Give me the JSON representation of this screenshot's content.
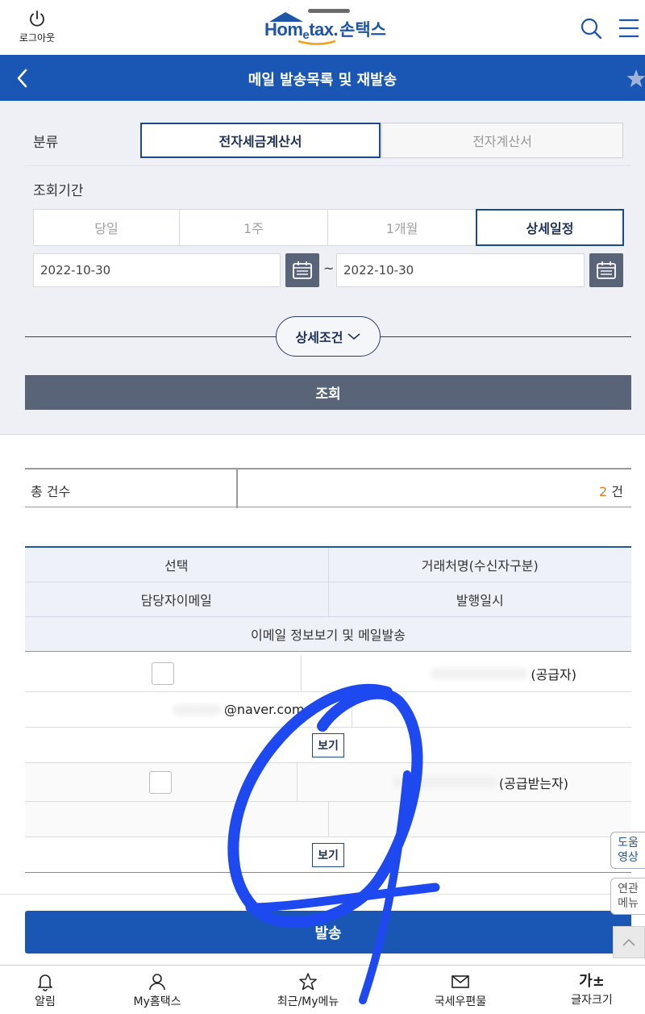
{
  "topbar": {
    "logout_label": "로그아웃",
    "logo_home": "Hom",
    "logo_e": "e",
    "logo_tax": "tax.",
    "logo_name": "손택스"
  },
  "header": {
    "title": "메일 발송목록 및 재발송"
  },
  "filter": {
    "category_label": "분류",
    "category_options": [
      "전자세금계산서",
      "전자계산서"
    ],
    "category_selected": "전자세금계산서",
    "period_label": "조회기간",
    "period_options": [
      "당일",
      "1주",
      "1개월",
      "상세일정"
    ],
    "period_selected": "상세일정",
    "date_from": "2022-10-30",
    "date_to": "2022-10-30",
    "tilde": "~",
    "advanced_label": "상세조건",
    "search_button": "조회"
  },
  "summary": {
    "total_label": "총 건수",
    "total_count": "2",
    "unit": "건"
  },
  "table": {
    "headers": [
      "선택",
      "거래처명(수신자구분)",
      "담당자이메일",
      "발행일시",
      "이메일 정보보기 및 메일발송"
    ],
    "rows": [
      {
        "party_suffix": "(공급자)",
        "email_suffix": "@naver.com",
        "view_label": "보기"
      },
      {
        "party_suffix": "(공급받는자)",
        "email_suffix": "",
        "view_label": "보기"
      }
    ]
  },
  "send_button": "발송",
  "side": {
    "help_video": [
      "도움",
      "영상"
    ],
    "related_menu": [
      "연관",
      "메뉴"
    ]
  },
  "bottom_nav": [
    {
      "label": "알림",
      "icon": "bell-icon"
    },
    {
      "label": "My홈택스",
      "icon": "person-icon"
    },
    {
      "label": "최근/My메뉴",
      "icon": "star-icon"
    },
    {
      "label": "국세우편물",
      "icon": "mail-icon"
    },
    {
      "label": "글자크기",
      "icon": "font-size-icon",
      "glyph": "가±"
    }
  ],
  "colors": {
    "brand_blue": "#1a57b4",
    "navy": "#1c4a86",
    "search_gray": "#596478",
    "count_orange": "#e07b1b",
    "scribble_blue": "#1f49f0"
  }
}
